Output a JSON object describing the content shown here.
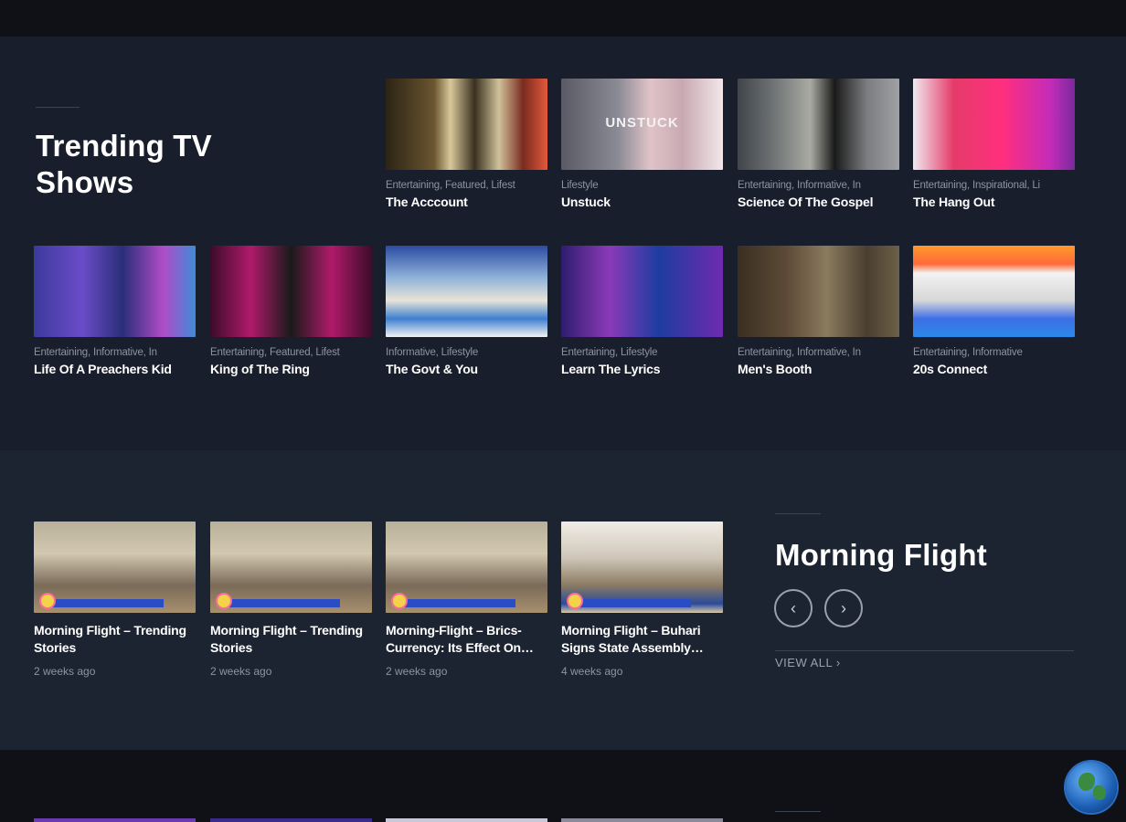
{
  "trending": {
    "heading": "Trending TV Shows",
    "shows": [
      {
        "categories": "Entertaining, Featured, Lifest",
        "title": "The Acccount",
        "thumb": "t1"
      },
      {
        "categories": "Lifestyle",
        "title": "Unstuck",
        "thumb": "t2",
        "overlay": "UNSTUCK"
      },
      {
        "categories": "Entertaining, Informative, In",
        "title": "Science Of The Gospel",
        "thumb": "t3"
      },
      {
        "categories": "Entertaining, Inspirational, Li",
        "title": "The Hang Out",
        "thumb": "t4"
      },
      {
        "categories": "Entertaining, Informative, In",
        "title": "Life Of A Preachers Kid",
        "thumb": "t5"
      },
      {
        "categories": "Entertaining, Featured, Lifest",
        "title": "King of The Ring",
        "thumb": "t6"
      },
      {
        "categories": "Informative, Lifestyle",
        "title": "The Govt & You",
        "thumb": "t7"
      },
      {
        "categories": "Entertaining, Lifestyle",
        "title": "Learn The Lyrics",
        "thumb": "t8"
      },
      {
        "categories": "Entertaining, Informative, In",
        "title": "Men's Booth",
        "thumb": "t9"
      },
      {
        "categories": "Entertaining, Informative",
        "title": "20s Connect",
        "thumb": "t10"
      }
    ]
  },
  "morning_flight": {
    "heading": "Morning Flight",
    "prev_icon": "chevron-left-icon",
    "next_icon": "chevron-right-icon",
    "prev_glyph": "‹",
    "next_glyph": "›",
    "view_all": "VIEW ALL ›",
    "videos": [
      {
        "title": "Morning Flight – Trending Stories",
        "age": "2 weeks ago",
        "thumb": "m1"
      },
      {
        "title": "Morning Flight – Trending Stories",
        "age": "2 weeks ago",
        "thumb": "m2"
      },
      {
        "title": "Morning-Flight – Brics-Currency: Its Effect On…",
        "age": "2 weeks ago",
        "thumb": "m3"
      },
      {
        "title": "Morning Flight – Buhari Signs State Assembly…",
        "age": "4 weeks ago",
        "thumb": "m4"
      }
    ]
  },
  "colors": {
    "page_bg": "#111319",
    "trending_bg": "#181e2b",
    "morning_bg": "#1d2431",
    "muted_text": "#8d93a1"
  },
  "floating": {
    "icon": "globe-icon"
  }
}
